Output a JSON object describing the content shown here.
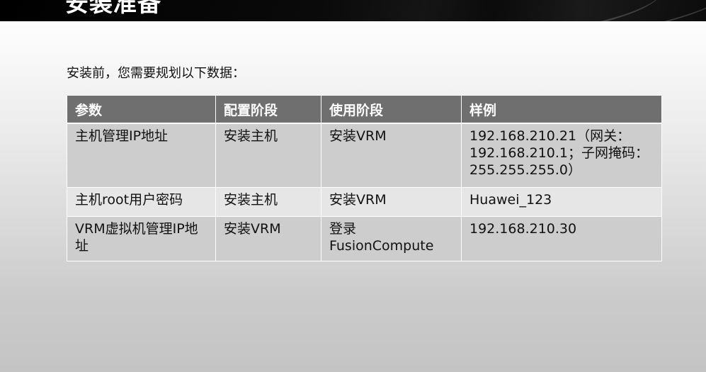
{
  "title": "安装准备",
  "intro": "安装前，您需要规划以下数据：",
  "table": {
    "headers": [
      "参数",
      "配置阶段",
      "使用阶段",
      "样例"
    ],
    "rows": [
      {
        "param": "主机管理IP地址",
        "config_stage": "安装主机",
        "use_stage": "安装VRM",
        "example": [
          "192.168.210.21（网关：",
          "192.168.210.1；子网掩码：",
          "255.255.255.0）"
        ]
      },
      {
        "param": "主机root用户密码",
        "config_stage": "安装主机",
        "use_stage": "安装VRM",
        "example": [
          "Huawei_123"
        ]
      },
      {
        "param": "VRM虚拟机管理IP地址",
        "config_stage": "安装VRM",
        "use_stage": "登录FusionCompute",
        "use_stage_lines": [
          "登录",
          "FusionCompute"
        ],
        "example": [
          "192.168.210.30"
        ]
      }
    ]
  }
}
